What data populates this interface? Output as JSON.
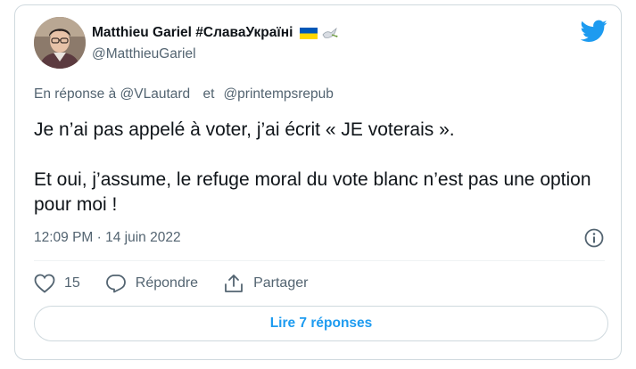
{
  "author": {
    "display_name": "Matthieu Gariel #СлаваУкраїні",
    "handle": "@MatthieuGariel",
    "flag_icon": "ukraine-flag-icon",
    "dove_icon": "dove-icon"
  },
  "reply_context": {
    "prefix": "En réponse à",
    "mention_1": "@VLautard",
    "conjunction": "et",
    "mention_2": "@printempsrepub"
  },
  "tweet": {
    "paragraph_1": "Je n’ai pas appelé à voter, j’ai écrit « JE voterais ».",
    "paragraph_2": "Et oui, j’assume, le refuge moral du vote blanc n’est pas une option pour moi !",
    "timestamp": "12:09 PM · 14 juin 2022"
  },
  "actions": {
    "like_count": "15",
    "reply_label": "Répondre",
    "share_label": "Partager"
  },
  "read_replies_label": "Lire 7 réponses",
  "colors": {
    "accent": "#1d9bf0",
    "text": "#0f1419",
    "secondary": "#536471",
    "border": "#cfd9de",
    "flag_blue": "#0057b7",
    "flag_yellow": "#ffd700"
  }
}
